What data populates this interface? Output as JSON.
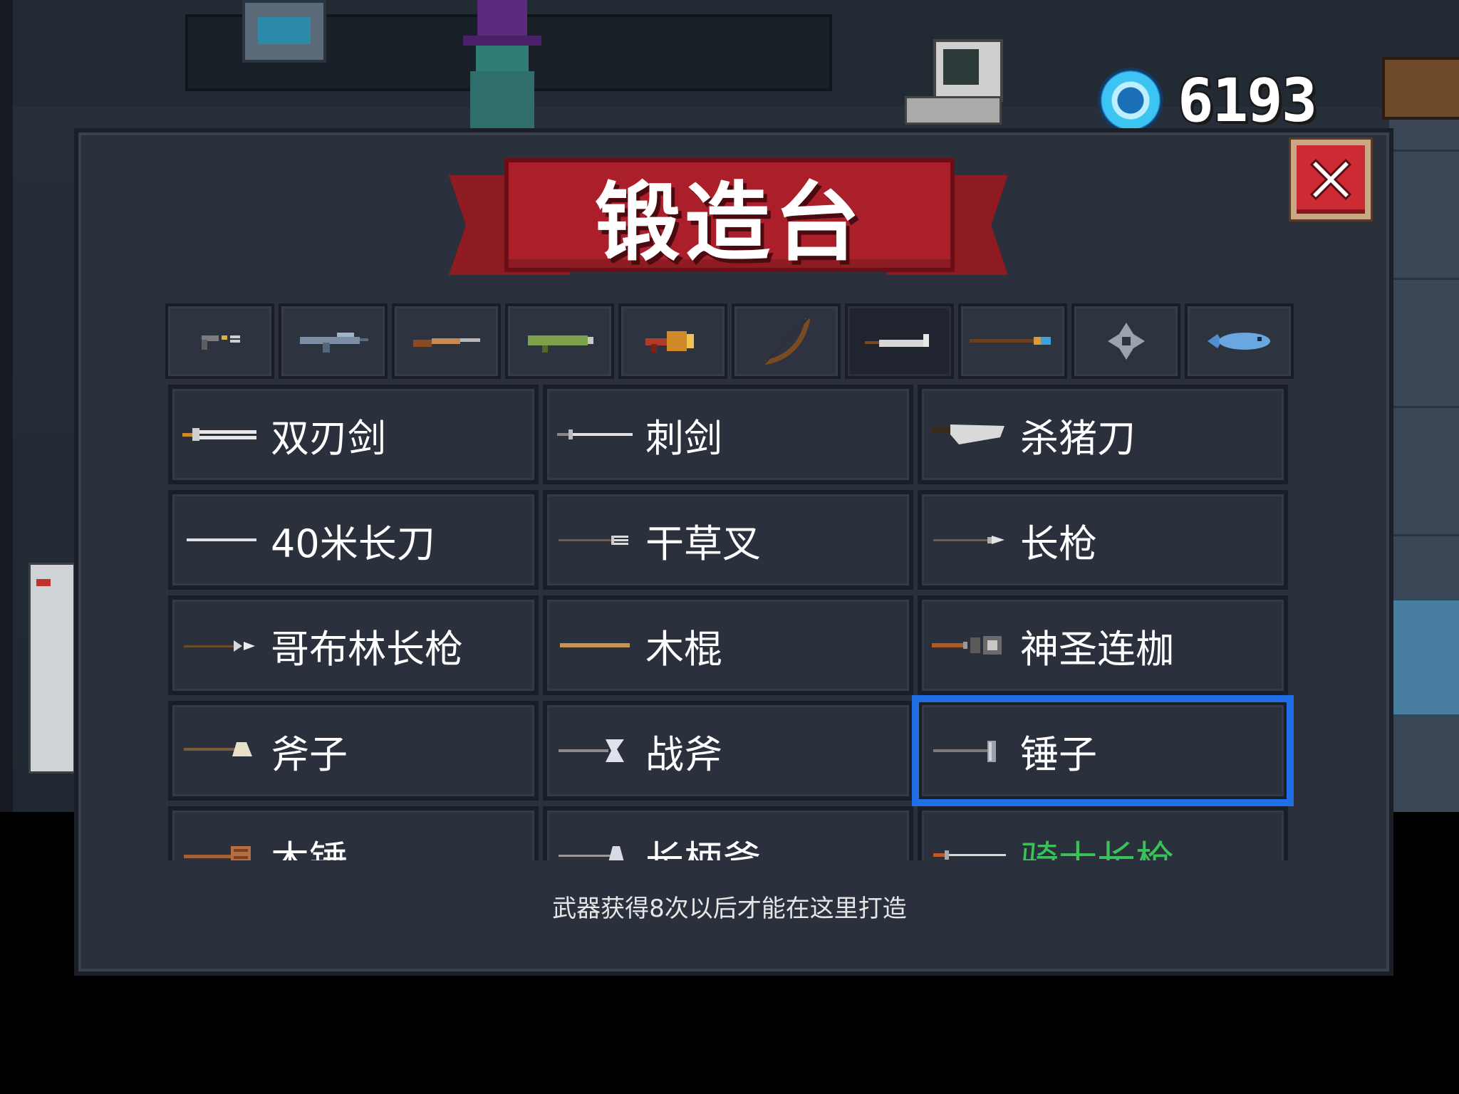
{
  "currency": {
    "icon": "gem-icon",
    "value": "6193"
  },
  "dialog": {
    "title": "锻造台",
    "close_icon": "close-icon",
    "footer_note": "武器获得8次以后才能在这里打造"
  },
  "tabs": [
    {
      "icon": "pistol-icon",
      "active": false
    },
    {
      "icon": "rifle-icon",
      "active": false
    },
    {
      "icon": "shotgun-icon",
      "active": false
    },
    {
      "icon": "launcher-icon",
      "active": false
    },
    {
      "icon": "flamethrower-icon",
      "active": false
    },
    {
      "icon": "bow-icon",
      "active": false
    },
    {
      "icon": "melee-blade-icon",
      "active": true
    },
    {
      "icon": "staff-icon",
      "active": false
    },
    {
      "icon": "shuriken-icon",
      "active": false
    },
    {
      "icon": "fish-icon",
      "active": false
    }
  ],
  "weapons": [
    {
      "name": "双刃剑",
      "icon": "double-blade-sword-icon",
      "color": "#ffffff",
      "selected": false
    },
    {
      "name": "刺剑",
      "icon": "rapier-icon",
      "color": "#ffffff",
      "selected": false
    },
    {
      "name": "杀猪刀",
      "icon": "butcher-knife-icon",
      "color": "#ffffff",
      "selected": false
    },
    {
      "name": "40米长刀",
      "icon": "long-blade-icon",
      "color": "#ffffff",
      "selected": false
    },
    {
      "name": "干草叉",
      "icon": "pitchfork-icon",
      "color": "#ffffff",
      "selected": false
    },
    {
      "name": "长枪",
      "icon": "spear-icon",
      "color": "#ffffff",
      "selected": false
    },
    {
      "name": "哥布林长枪",
      "icon": "goblin-spear-icon",
      "color": "#ffffff",
      "selected": false
    },
    {
      "name": "木棍",
      "icon": "wooden-staff-icon",
      "color": "#ffffff",
      "selected": false
    },
    {
      "name": "神圣连枷",
      "icon": "holy-flail-icon",
      "color": "#ffffff",
      "selected": false
    },
    {
      "name": "斧子",
      "icon": "axe-icon",
      "color": "#ffffff",
      "selected": false
    },
    {
      "name": "战斧",
      "icon": "battle-axe-icon",
      "color": "#ffffff",
      "selected": false
    },
    {
      "name": "锤子",
      "icon": "hammer-icon",
      "color": "#ffffff",
      "selected": true
    },
    {
      "name": "木锤",
      "icon": "wooden-mallet-icon",
      "color": "#ffffff",
      "selected": false
    },
    {
      "name": "长柄斧",
      "icon": "halberd-icon",
      "color": "#ffffff",
      "selected": false
    },
    {
      "name": "骑士长枪",
      "icon": "knight-lance-icon",
      "color": "#3ac15a",
      "selected": false
    }
  ],
  "colors": {
    "selection": "#1f6fe6",
    "banner": "#aa1f29",
    "panel": "#2b303d",
    "rare_name": "#3ac15a"
  }
}
